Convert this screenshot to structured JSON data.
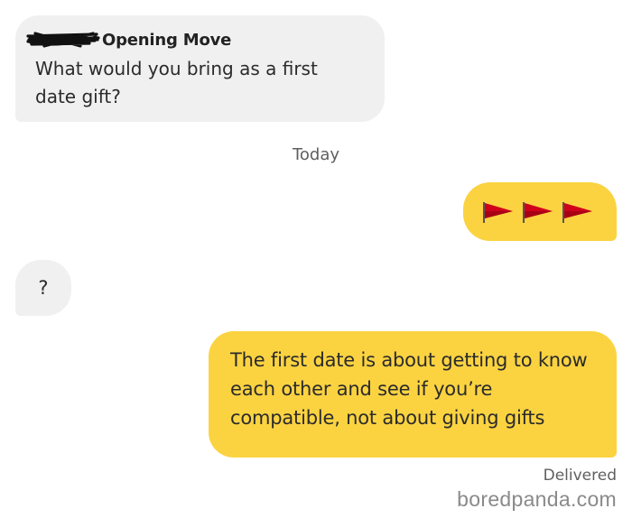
{
  "opening_move": {
    "label": "Opening Move",
    "question": "What would you bring as a first date gift?"
  },
  "divider": {
    "today": "Today"
  },
  "messages": {
    "flags": {
      "icon": "red-flag-icon",
      "count": 3,
      "flag_color": "#d0021b"
    },
    "question_mark": "?",
    "reply": "The first date is about getting to know each other and see if you’re compatible, not about giving gifts"
  },
  "status": {
    "delivered": "Delivered"
  },
  "watermark": "boredpanda.com",
  "colors": {
    "incoming_bubble": "#f0f0f0",
    "outgoing_bubble": "#fbd341",
    "background": "#ffffff"
  }
}
